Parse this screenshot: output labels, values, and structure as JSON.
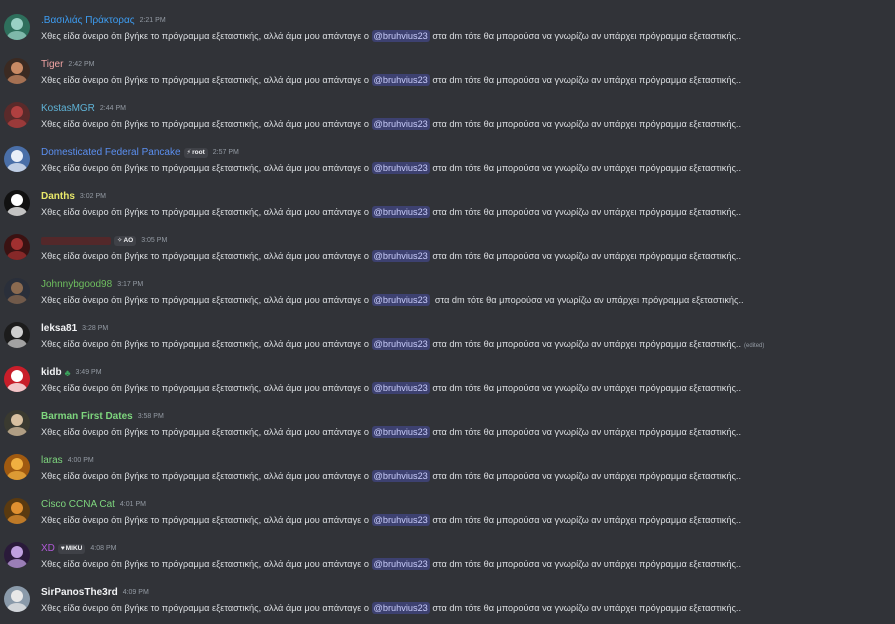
{
  "messages": [
    {
      "username": ".Βασιλιάς Πράκτορας",
      "name_color": "#3d9df2",
      "bold": false,
      "timestamp": "2:21 PM",
      "text_before": "Χθες είδα όνειρο ότι βγήκε το πρόγραμμα εξεταστικής, αλλά άμα μου απάνταγε ο ",
      "mention": "@bruhvius23",
      "text_after": " στα dm τότε θα μπορούσα να γνωρίζω αν υπάρχει πρόγραμμα εξεταστικής..",
      "avatar_icon": "anime-avatar-icon",
      "avatar_colors": [
        "#2e6f5c",
        "#9ad0c4"
      ]
    },
    {
      "username": "Tiger",
      "name_color": "#f0a3a3",
      "bold": false,
      "timestamp": "2:42 PM",
      "text_before": "Χθες είδα όνειρο ότι βγήκε το πρόγραμμα εξεταστικής, αλλά άμα μου απάνταγε ο ",
      "mention": "@bruhvius23",
      "text_after": " στα dm τότε θα μπορούσα να γνωρίζω αν υπάρχει πρόγραμμα εξεταστικής..",
      "avatar_icon": "person-avatar-icon",
      "avatar_colors": [
        "#3b2a22",
        "#c98a64"
      ]
    },
    {
      "username": "KostasMGR",
      "name_color": "#5fb3d6",
      "bold": false,
      "timestamp": "2:44 PM",
      "text_before": "Χθες είδα όνειρο ότι βγήκε το πρόγραμμα εξεταστικής, αλλά άμα μου απάνταγε ο ",
      "mention": "@bruhvius23",
      "text_after": " στα dm τότε θα μπορούσα να γνωρίζω αν υπάρχει πρόγραμμα εξεταστικής..",
      "avatar_icon": "character-avatar-icon",
      "avatar_colors": [
        "#5a2a2a",
        "#b04040"
      ]
    },
    {
      "username": "Domesticated Federal Pancake",
      "name_color": "#5b8ff0",
      "bold": false,
      "timestamp": "2:57 PM",
      "tag": "root",
      "tag_icon": "⚡",
      "text_before": "Χθες είδα όνειρο ότι βγήκε το πρόγραμμα εξεταστικής, αλλά άμα μου απάνταγε ο ",
      "mention": "@bruhvius23",
      "text_after": " στα dm τότε θα μπορούσα να γνωρίζω αν υπάρχει πρόγραμμα εξεταστικής..",
      "avatar_icon": "anime-avatar-icon",
      "avatar_colors": [
        "#4a6fa8",
        "#e8eef8"
      ]
    },
    {
      "username": "Danths",
      "name_color": "#e8e86a",
      "bold": true,
      "timestamp": "3:02 PM",
      "text_before": "Χθες είδα όνειρο ότι βγήκε το πρόγραμμα εξεταστικής, αλλά άμα μου απάνταγε ο ",
      "mention": "@bruhvius23",
      "text_after": " στα dm τότε θα μπορούσα να γνωρίζω αν υπάρχει πρόγραμμα εξεταστικής..",
      "avatar_icon": "dark-avatar-icon",
      "avatar_colors": [
        "#111111",
        "#ffffff"
      ]
    },
    {
      "username": "",
      "name_color": "#6b2222",
      "bold": false,
      "timestamp": "3:05 PM",
      "tag": "AO",
      "tag_icon": "✧",
      "text_before": "Χθες είδα όνειρο ότι βγήκε το πρόγραμμα εξεταστικής, αλλά άμα μου απάνταγε ο ",
      "mention": "@bruhvius23",
      "text_after": " στα dm τότε θα μπορούσα να γνωρίζω αν υπάρχει πρόγραμμα εξεταστικής..",
      "avatar_icon": "character-avatar-icon",
      "avatar_colors": [
        "#3a1212",
        "#a03030"
      ]
    },
    {
      "username": "Johnnybgood98",
      "name_color": "#6fbf5f",
      "bold": false,
      "timestamp": "3:17 PM",
      "text_before": "Χθες είδα όνειρο ότι βγήκε το πρόγραμμα εξεταστικής, αλλά άμα μου απάνταγε ο ",
      "mention": "@bruhvius23",
      "text_after": "  στα dm τότε θα μπορούσα να γνωρίζω αν υπάρχει πρόγραμμα εξεταστικής..",
      "avatar_icon": "person-avatar-icon",
      "avatar_colors": [
        "#2a2f3a",
        "#8a6a50"
      ]
    },
    {
      "username": "leksa81",
      "name_color": "#f2f3f5",
      "bold": true,
      "timestamp": "3:28 PM",
      "text_before": "Χθες είδα όνειρο ότι βγήκε το πρόγραμμα εξεταστικής, αλλά άμα μου απάνταγε ο ",
      "mention": "@bruhvius23",
      "text_after": " στα dm τότε θα μπορούσα να γνωρίζω αν υπάρχει πρόγραμμα εξεταστικής..",
      "edited": "(edited)",
      "avatar_icon": "character-avatar-icon",
      "avatar_colors": [
        "#1c1c1c",
        "#cfcfcf"
      ]
    },
    {
      "username": "kidb",
      "name_color": "#f2f3f5",
      "bold": true,
      "timestamp": "3:49 PM",
      "badge": "♣",
      "text_before": "Χθες είδα όνειρο ότι βγήκε το πρόγραμμα εξεταστικής, αλλά άμα μου απάνταγε ο ",
      "mention": "@bruhvius23",
      "text_after": " στα dm τότε θα μπορούσα να γνωρίζω αν υπάρχει πρόγραμμα εξεταστικής..",
      "avatar_icon": "anime-avatar-icon",
      "avatar_colors": [
        "#c81e2a",
        "#ffffff"
      ]
    },
    {
      "username": "Barman First Dates",
      "name_color": "#7ed67e",
      "bold": true,
      "timestamp": "3:58 PM",
      "text_before": "Χθες είδα όνειρο ότι βγήκε το πρόγραμμα εξεταστικής, αλλά άμα μου απάνταγε ο ",
      "mention": "@bruhvius23",
      "text_after": " στα dm τότε θα μπορούσα να γνωρίζω αν υπάρχει πρόγραμμα εξεταστικής..",
      "avatar_icon": "person-avatar-icon",
      "avatar_colors": [
        "#3a3a30",
        "#d8c0a0"
      ]
    },
    {
      "username": "laras",
      "name_color": "#7ed67e",
      "bold": false,
      "timestamp": "4:00 PM",
      "text_before": "Χθες είδα όνειρο ότι βγήκε το πρόγραμμα εξεταστικής, αλλά άμα μου απάνταγε ο ",
      "mention": "@bruhvius23",
      "text_after": " στα dm τότε θα μπορούσα να γνωρίζω αν υπάρχει πρόγραμμα εξεταστικής..",
      "avatar_icon": "character-avatar-icon",
      "avatar_colors": [
        "#a05a10",
        "#f0b040"
      ]
    },
    {
      "username": "Cisco CCNA Cat",
      "name_color": "#7ed67e",
      "bold": false,
      "timestamp": "4:01 PM",
      "text_before": "Χθες είδα όνειρο ότι βγήκε το πρόγραμμα εξεταστικής, αλλά άμα μου απάνταγε ο ",
      "mention": "@bruhvius23",
      "text_after": " στα dm τότε θα μπορούσα να γνωρίζω αν υπάρχει πρόγραμμα εξεταστικής..",
      "avatar_icon": "cat-avatar-icon",
      "avatar_colors": [
        "#5a3a10",
        "#e09030"
      ]
    },
    {
      "username": "XD",
      "name_color": "#b05ad8",
      "bold": false,
      "timestamp": "4:08 PM",
      "tag": "MIKU",
      "tag_icon": "♥",
      "text_before": "Χθες είδα όνειρο ότι βγήκε το πρόγραμμα εξεταστικής, αλλά άμα μου απάνταγε ο ",
      "mention": "@bruhvius23",
      "text_after": " στα dm τότε θα μπορούσα να γνωρίζω αν υπάρχει πρόγραμμα εξεταστικής..",
      "avatar_icon": "anime-avatar-icon",
      "avatar_colors": [
        "#2a1a3a",
        "#c0a0e0"
      ]
    },
    {
      "username": "SirPanosThe3rd",
      "name_color": "#f2f3f5",
      "bold": true,
      "timestamp": "4:09 PM",
      "text_before": "Χθες είδα όνειρο ότι βγήκε το πρόγραμμα εξεταστικής, αλλά άμα μου απάνταγε ο ",
      "mention": "@bruhvius23",
      "text_after": " στα dm τότε θα μπορούσα να γνωρίζω αν υπάρχει πρόγραμμα εξεταστικής..",
      "avatar_icon": "person-avatar-icon",
      "avatar_colors": [
        "#8a9aaa",
        "#e8e8e8"
      ]
    }
  ]
}
